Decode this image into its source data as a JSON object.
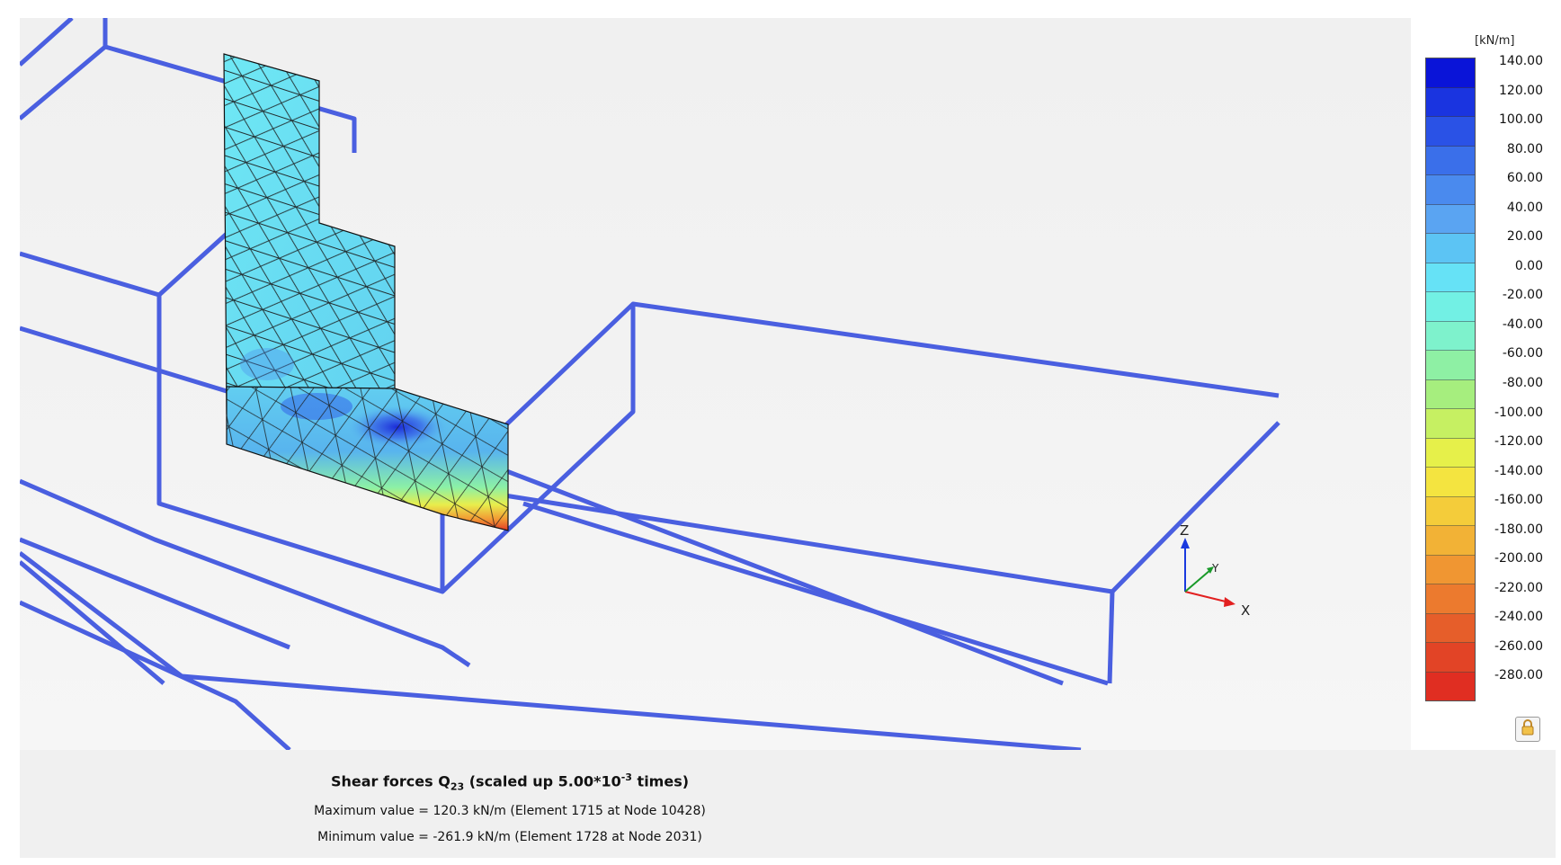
{
  "result": {
    "title_prefix": "Shear forces Q",
    "title_subscript": "23",
    "title_scale_prefix": "(scaled up 5.00*10",
    "title_scale_exponent": "-3",
    "title_suffix": "times)",
    "maximum_line": "Maximum value = 120.3 kN/m (Element 1715 at Node 10428)",
    "minimum_line": "Minimum value = -261.9 kN/m (Element 1728 at Node 2031)"
  },
  "legend": {
    "unit": "[kN/m]",
    "labels": [
      "140.00",
      "120.00",
      "100.00",
      "80.00",
      "60.00",
      "40.00",
      "20.00",
      "0.00",
      "-20.00",
      "-40.00",
      "-60.00",
      "-80.00",
      "-100.00",
      "-120.00",
      "-140.00",
      "-160.00",
      "-180.00",
      "-200.00",
      "-220.00",
      "-240.00",
      "-260.00",
      "-280.00"
    ],
    "colors": [
      "#0a14d8",
      "#1a34e0",
      "#2a52e6",
      "#3a6fea",
      "#4a8aee",
      "#5aa4f2",
      "#5cc4f4",
      "#66e2f6",
      "#72f0e4",
      "#7ef2cc",
      "#8ef0a4",
      "#a6ee7e",
      "#c6f062",
      "#e6f04a",
      "#f4e440",
      "#f4cc3a",
      "#f2b236",
      "#f09632",
      "#ec7a2e",
      "#e65e2a",
      "#e24426",
      "#e02e22"
    ],
    "lock_icon": "lock-icon"
  },
  "axes": {
    "x_label": "X",
    "y_label": "Y",
    "z_label": "Z",
    "x_color": "#e22020",
    "y_color": "#1a9a2a",
    "z_color": "#1a3adf"
  },
  "colors": {
    "frame_lines": "#4a5fe0",
    "viewport_bg": "#f1f1f1",
    "info_bg": "#f0f0f0"
  }
}
